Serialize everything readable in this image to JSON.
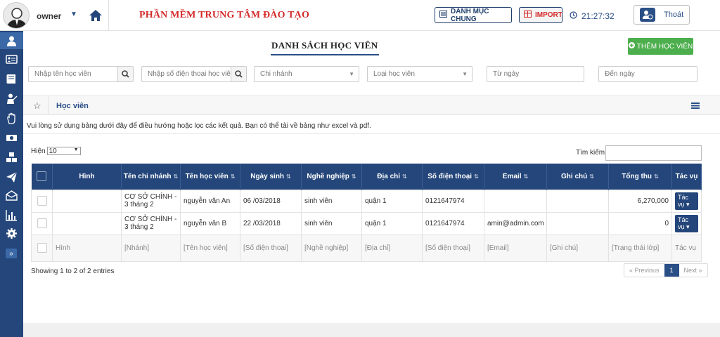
{
  "header": {
    "username": "owner",
    "app_title": "PHẦN MỀM TRUNG TÂM ĐÀO TẠO",
    "btn_danh_muc": "DANH MỤC CHUNG",
    "btn_import": "IMPORT",
    "clock": "21:27:32",
    "logout": "Thoát"
  },
  "page": {
    "title": "DANH SÁCH HỌC VIÊN",
    "add_button": "THÊM HỌC VIÊN"
  },
  "filters": {
    "name_placeholder": "Nhập tên học viên",
    "phone_placeholder": "Nhập số điện thoại học viên",
    "branch_placeholder": "Chi nhánh",
    "type_placeholder": "Loại học viên",
    "from_placeholder": "Từ ngày",
    "to_placeholder": "Đến ngày"
  },
  "panel": {
    "title": "Học viên",
    "note": "Vui lòng sử dụng bảng dưới đây để điều hướng hoặc lọc các kết quả. Bạn có thể tải về bảng như excel và pdf."
  },
  "table_controls": {
    "show_label": "Hiện",
    "show_value": "10",
    "search_label": "Tìm kiếm"
  },
  "table": {
    "headers": [
      "Hình",
      "Tên chi nhánh",
      "Tên học viên",
      "Ngày sinh",
      "Nghề nghiệp",
      "Địa chỉ",
      "Số điện thoại",
      "Email",
      "Ghi chú",
      "Tổng thu",
      "Tác vụ"
    ],
    "rows": [
      {
        "branch": "CƠ SỞ CHÍNH - 3 tháng 2",
        "name": "nguyễn văn An",
        "dob": "06 /03/2018",
        "job": "sinh viên",
        "address": "quận 1",
        "phone": "0121647974",
        "email": "",
        "note": "",
        "total": "6,270,000",
        "action": "Tác vụ ▾"
      },
      {
        "branch": "CƠ SỞ CHÍNH - 3 tháng 2",
        "name": "nguyễn văn B",
        "dob": "22 /03/2018",
        "job": "sinh viên",
        "address": "quận 1",
        "phone": "0121647974",
        "email": "amin@admin.com",
        "note": "",
        "total": "0",
        "action": "Tác vụ ▾"
      }
    ],
    "footer": [
      "Hình",
      "[Nhánh]",
      "[Tên học viên]",
      "[Số điện thoại]",
      "[Nghề nghiệp]",
      "[Địa chỉ]",
      "[Số điện thoại]",
      "[Email]",
      "[Ghi chú]",
      "[Trạng thái lớp]",
      "Tác vụ"
    ]
  },
  "pagination": {
    "showing": "Showing 1 to 2 of 2 entries",
    "prev": "« Previous",
    "current": "1",
    "next": "Next »"
  },
  "sidebar_icons": [
    "students-icon",
    "id-card-icon",
    "book-icon",
    "teacher-icon",
    "hand-icon",
    "money-icon",
    "cubes-icon",
    "send-icon",
    "envelope-icon",
    "bar-chart-icon",
    "settings-icon"
  ]
}
